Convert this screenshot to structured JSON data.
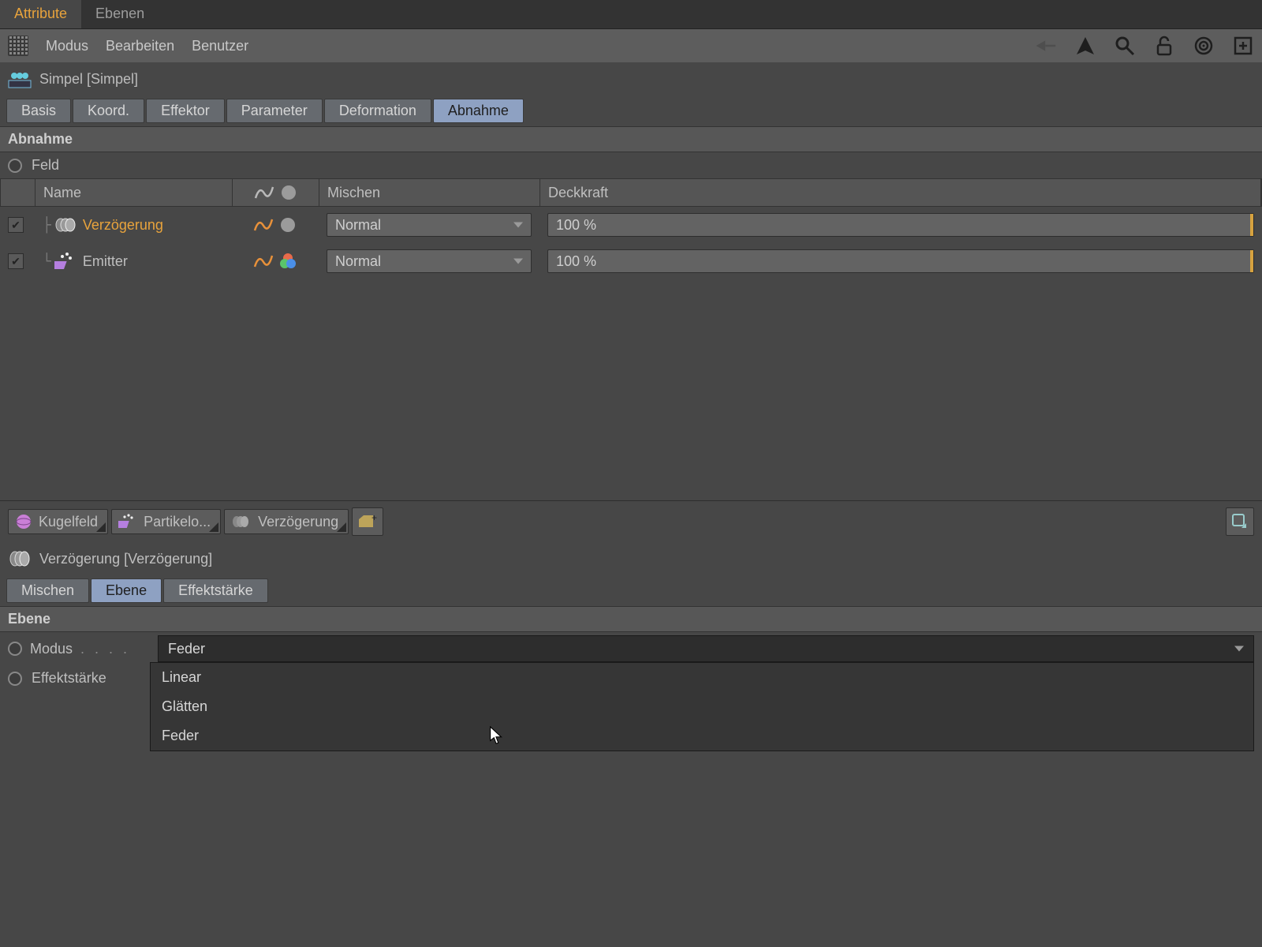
{
  "topTabs": {
    "attribute": "Attribute",
    "ebenen": "Ebenen"
  },
  "menus": {
    "modus": "Modus",
    "bearbeiten": "Bearbeiten",
    "benutzer": "Benutzer"
  },
  "object": {
    "title": "Simpel [Simpel]"
  },
  "attrTabs": {
    "basis": "Basis",
    "koord": "Koord.",
    "effektor": "Effektor",
    "parameter": "Parameter",
    "deformation": "Deformation",
    "abnahme": "Abnahme"
  },
  "sections": {
    "abnahme": "Abnahme",
    "ebene": "Ebene"
  },
  "feld": {
    "label": "Feld"
  },
  "fieldTable": {
    "headers": {
      "name": "Name",
      "mischen": "Mischen",
      "deckkraft": "Deckkraft"
    },
    "rows": [
      {
        "name": "Verzögerung",
        "mix": "Normal",
        "opacity": "100 %",
        "selected": true,
        "icon": "delay"
      },
      {
        "name": "Emitter",
        "mix": "Normal",
        "opacity": "100 %",
        "selected": false,
        "icon": "emitter"
      }
    ]
  },
  "crumbs": {
    "a": "Kugelfeld",
    "b": "Partikelo...",
    "c": "Verzögerung"
  },
  "lowerObject": {
    "title": "Verzögerung [Verzögerung]"
  },
  "lowerTabs": {
    "mischen": "Mischen",
    "ebene": "Ebene",
    "effekt": "Effektstärke"
  },
  "modus": {
    "label": "Modus",
    "value": "Feder",
    "options": {
      "a": "Linear",
      "b": "Glätten",
      "c": "Feder"
    }
  },
  "effektstaerke": {
    "label": "Effektstärke"
  }
}
